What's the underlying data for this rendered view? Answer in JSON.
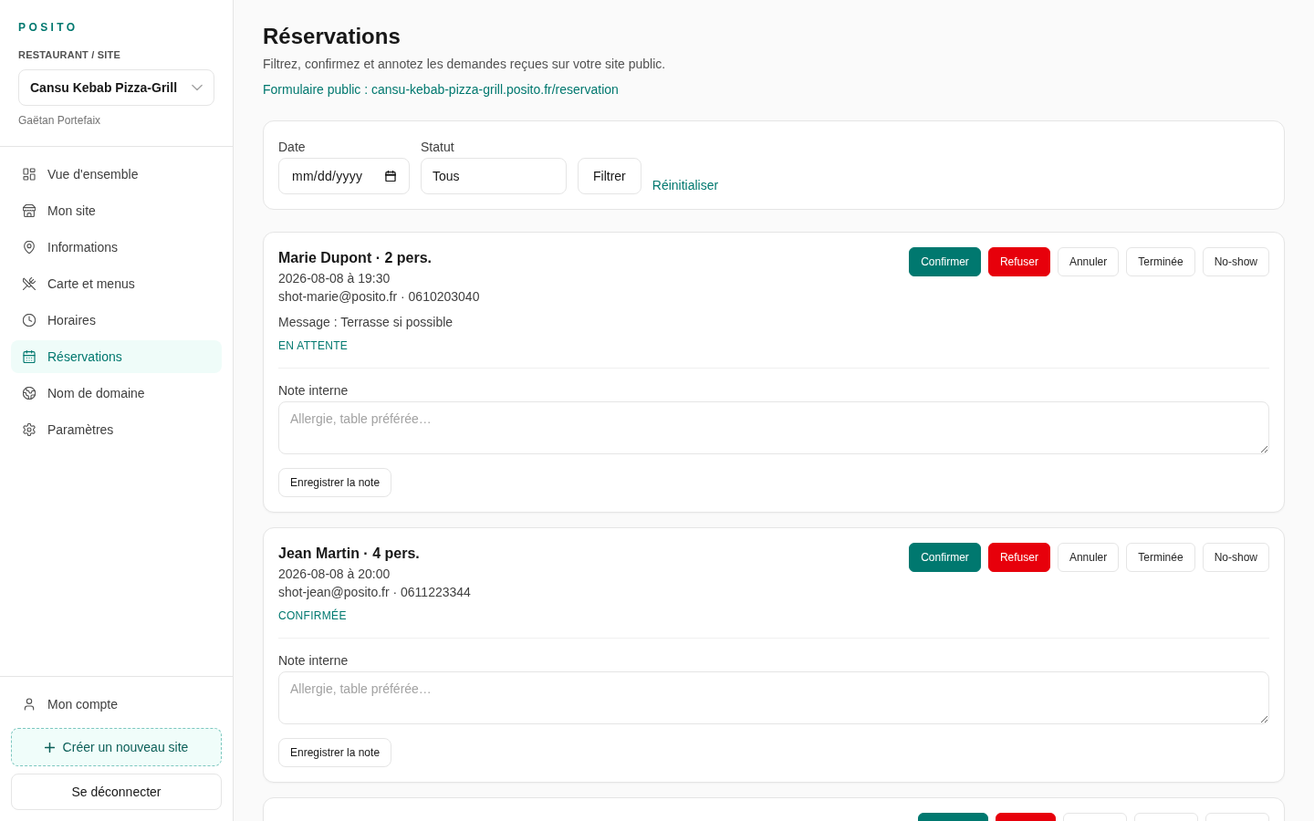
{
  "sidebar": {
    "logo": "POSITO",
    "site_label": "RESTAURANT / SITE",
    "site_select": {
      "value": "Cansu Kebab Pizza-Grill"
    },
    "owner": "Gaëtan Portefaix",
    "nav": [
      {
        "label": "Vue d'ensemble",
        "selected": false
      },
      {
        "label": "Mon site",
        "selected": false
      },
      {
        "label": "Informations",
        "selected": false
      },
      {
        "label": "Carte et menus",
        "selected": false
      },
      {
        "label": "Horaires",
        "selected": false
      },
      {
        "label": "Réservations",
        "selected": true
      },
      {
        "label": "Nom de domaine",
        "selected": false
      },
      {
        "label": "Paramètres",
        "selected": false
      }
    ],
    "account": {
      "label": "Mon compte"
    },
    "create_button": "Créer un nouveau site",
    "logout_button": "Se déconnecter"
  },
  "header": {
    "title": "Réservations",
    "subtitle": "Filtrez, confirmez et annotez les demandes reçues sur votre site public.",
    "public_link": "Formulaire public : cansu-kebab-pizza-grill.posito.fr/reservation"
  },
  "filters": {
    "date": {
      "label": "Date",
      "placeholder": "mm/dd/yyyy"
    },
    "status": {
      "label": "Statut",
      "value": "Tous"
    },
    "filter_button": "Filtrer",
    "reset_link": "Réinitialiser"
  },
  "reservations": [
    {
      "title": "Marie Dupont · 2 pers.",
      "datetime": "2026-08-08 à 19:30",
      "contact": "shot-marie@posito.fr · 0610203040",
      "message": "Message : Terrasse si possible",
      "status": "EN ATTENTE",
      "actions": [
        {
          "label": "Confirmer",
          "kind": "primary"
        },
        {
          "label": "Refuser",
          "kind": "danger"
        },
        {
          "label": "Annuler",
          "kind": "neutral"
        },
        {
          "label": "Terminée",
          "kind": "neutral"
        },
        {
          "label": "No-show",
          "kind": "neutral"
        }
      ],
      "note": {
        "label": "Note interne",
        "placeholder": "Allergie, table préférée…"
      },
      "save_button": "Enregistrer la note"
    },
    {
      "title": "Jean Martin · 4 pers.",
      "datetime": "2026-08-08 à 20:00",
      "contact": "shot-jean@posito.fr · 0611223344",
      "status": "CONFIRMÉE",
      "actions": [
        {
          "label": "Confirmer",
          "kind": "primary"
        },
        {
          "label": "Refuser",
          "kind": "danger"
        },
        {
          "label": "Annuler",
          "kind": "neutral"
        },
        {
          "label": "Terminée",
          "kind": "neutral"
        },
        {
          "label": "No-show",
          "kind": "neutral"
        }
      ],
      "note": {
        "label": "Note interne",
        "placeholder": "Allergie, table préférée…"
      },
      "save_button": "Enregistrer la note"
    },
    {
      "actions": [
        {
          "kind": "primary"
        },
        {
          "kind": "danger"
        },
        {
          "kind": "neutral"
        },
        {
          "kind": "neutral"
        },
        {
          "kind": "neutral"
        }
      ]
    }
  ]
}
